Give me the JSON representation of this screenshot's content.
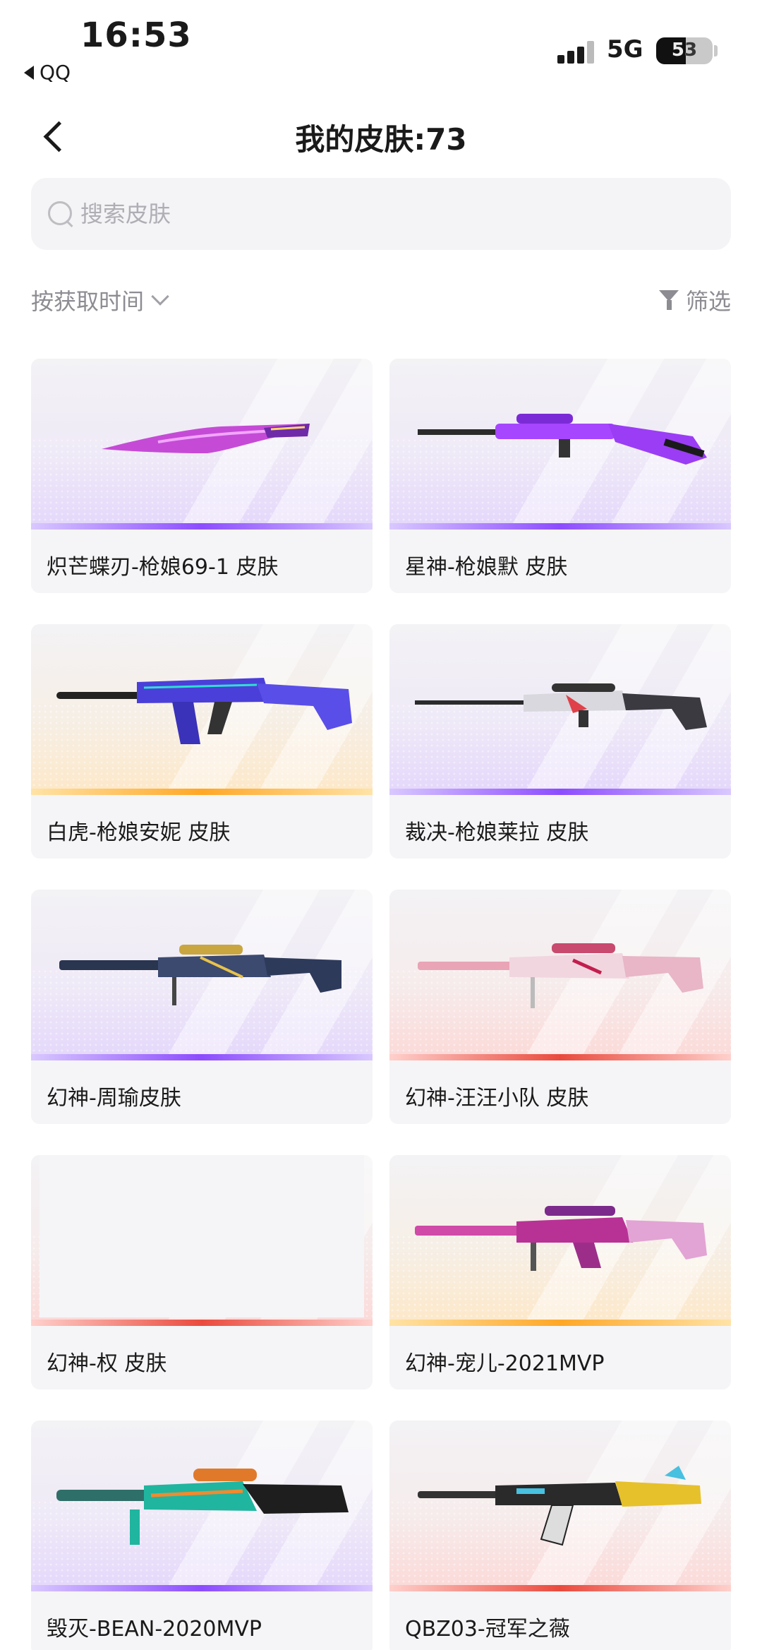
{
  "status": {
    "time": "16:53",
    "back_app": "QQ",
    "network": "5G",
    "battery": "53"
  },
  "nav": {
    "title": "我的皮肤:73"
  },
  "search": {
    "placeholder": "搜索皮肤"
  },
  "toolbar": {
    "sort_label": "按获取时间",
    "filter_label": "筛选"
  },
  "colors": {
    "purple": "#8c4cff",
    "orange": "#ffa726",
    "red": "#ea4a3d"
  },
  "skins": [
    {
      "name": "炽芒蝶刃-枪娘69-1 皮肤",
      "rarity": "purple",
      "icon": "knife-icon"
    },
    {
      "name": "星神-枪娘默 皮肤",
      "rarity": "purple",
      "icon": "rifle-icon"
    },
    {
      "name": "白虎-枪娘安妮 皮肤",
      "rarity": "orange",
      "icon": "assault-rifle-icon"
    },
    {
      "name": "裁决-枪娘莱拉 皮肤",
      "rarity": "purple",
      "icon": "sniper-rifle-icon"
    },
    {
      "name": "幻神-周瑜皮肤",
      "rarity": "purple",
      "icon": "sniper-rifle-icon"
    },
    {
      "name": "幻神-汪汪小队 皮肤",
      "rarity": "red",
      "icon": "sniper-rifle-icon"
    },
    {
      "name": "幻神-权 皮肤",
      "rarity": "red",
      "icon": "empty-image-icon"
    },
    {
      "name": "幻神-宠儿-2021MVP",
      "rarity": "orange",
      "icon": "sniper-rifle-icon"
    },
    {
      "name": "毁灭-BEAN-2020MVP",
      "rarity": "purple",
      "icon": "heavy-sniper-icon"
    },
    {
      "name": "QBZ03-冠军之薇",
      "rarity": "red",
      "icon": "assault-rifle-icon"
    }
  ]
}
